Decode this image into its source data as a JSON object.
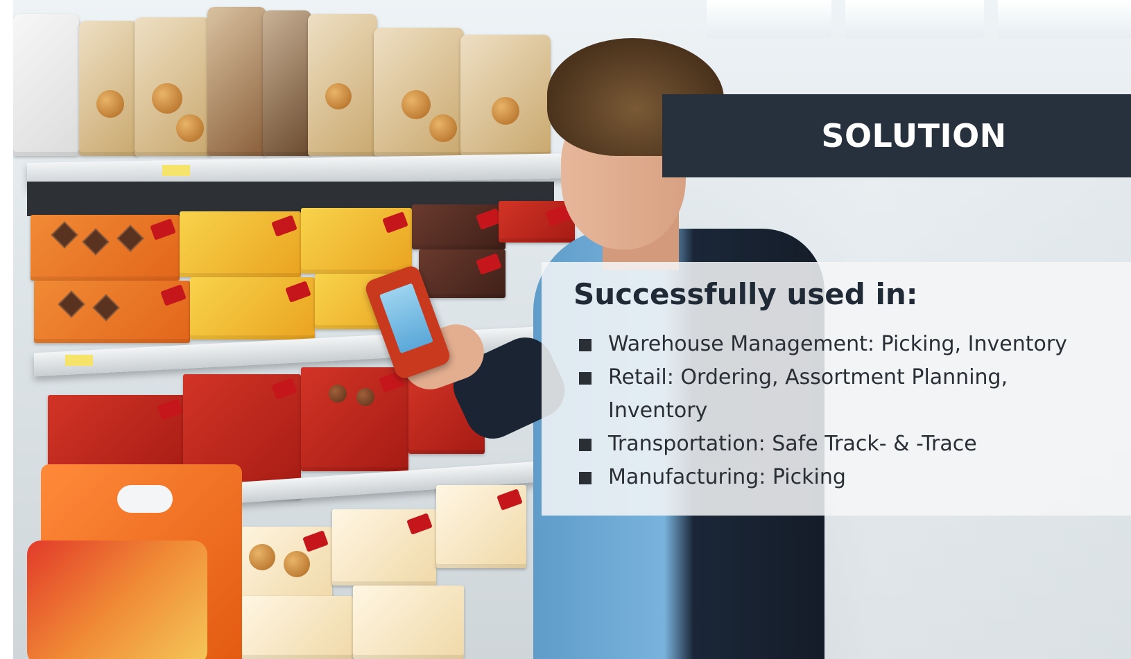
{
  "slide": {
    "title": "SOLUTION",
    "heading": "Successfully used in:",
    "bullets": [
      "Warehouse Management: Picking, Inventory",
      "Retail: Ordering, Assortment Planning, Inventory",
      "Transportation: Safe Track- & -Trace",
      "Manufacturing: Picking"
    ]
  },
  "colors": {
    "title_bar": "#26313d",
    "title_text": "#ffffff",
    "content_box": "#f5f6f7",
    "heading_text": "#1f2a36",
    "body_text": "#2a2f35"
  }
}
